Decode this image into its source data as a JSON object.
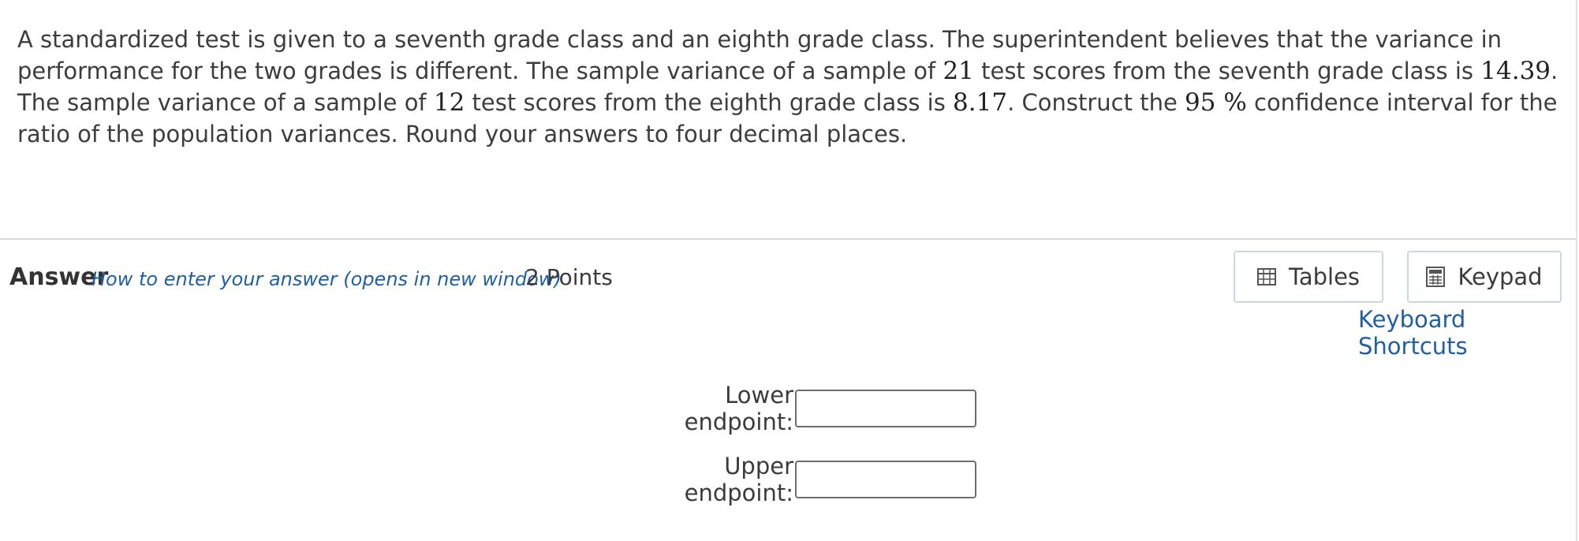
{
  "question": {
    "t1": "A standardized test is given to a seventh grade class and an eighth grade class. The superintendent believes that the variance in performance for the two grades is different. The sample variance of a sample of ",
    "n1": "21",
    "t2": " test scores from the seventh grade class is ",
    "v1": "14.39",
    "t3": ". The sample variance of a sample of ",
    "n2": "12",
    "t4": " test scores from the eighth grade class is ",
    "v2": "8.17",
    "t5": ". Construct the ",
    "conf": "95 %",
    "t6": " confidence interval for the ratio of the population variances. Round your answers to four decimal places."
  },
  "answer": {
    "label": "Answer",
    "help_link": "How to enter your answer (opens in new window)",
    "points": "2 Points"
  },
  "tools": {
    "tables_label": "Tables",
    "tables_icon": "table-grid-icon",
    "keypad_label": "Keypad",
    "keypad_icon": "calculator-icon",
    "shortcuts_link": "Keyboard Shortcuts"
  },
  "fields": {
    "lower_label": "Lower endpoint:",
    "lower_value": "",
    "upper_label": "Upper endpoint:",
    "upper_value": ""
  }
}
